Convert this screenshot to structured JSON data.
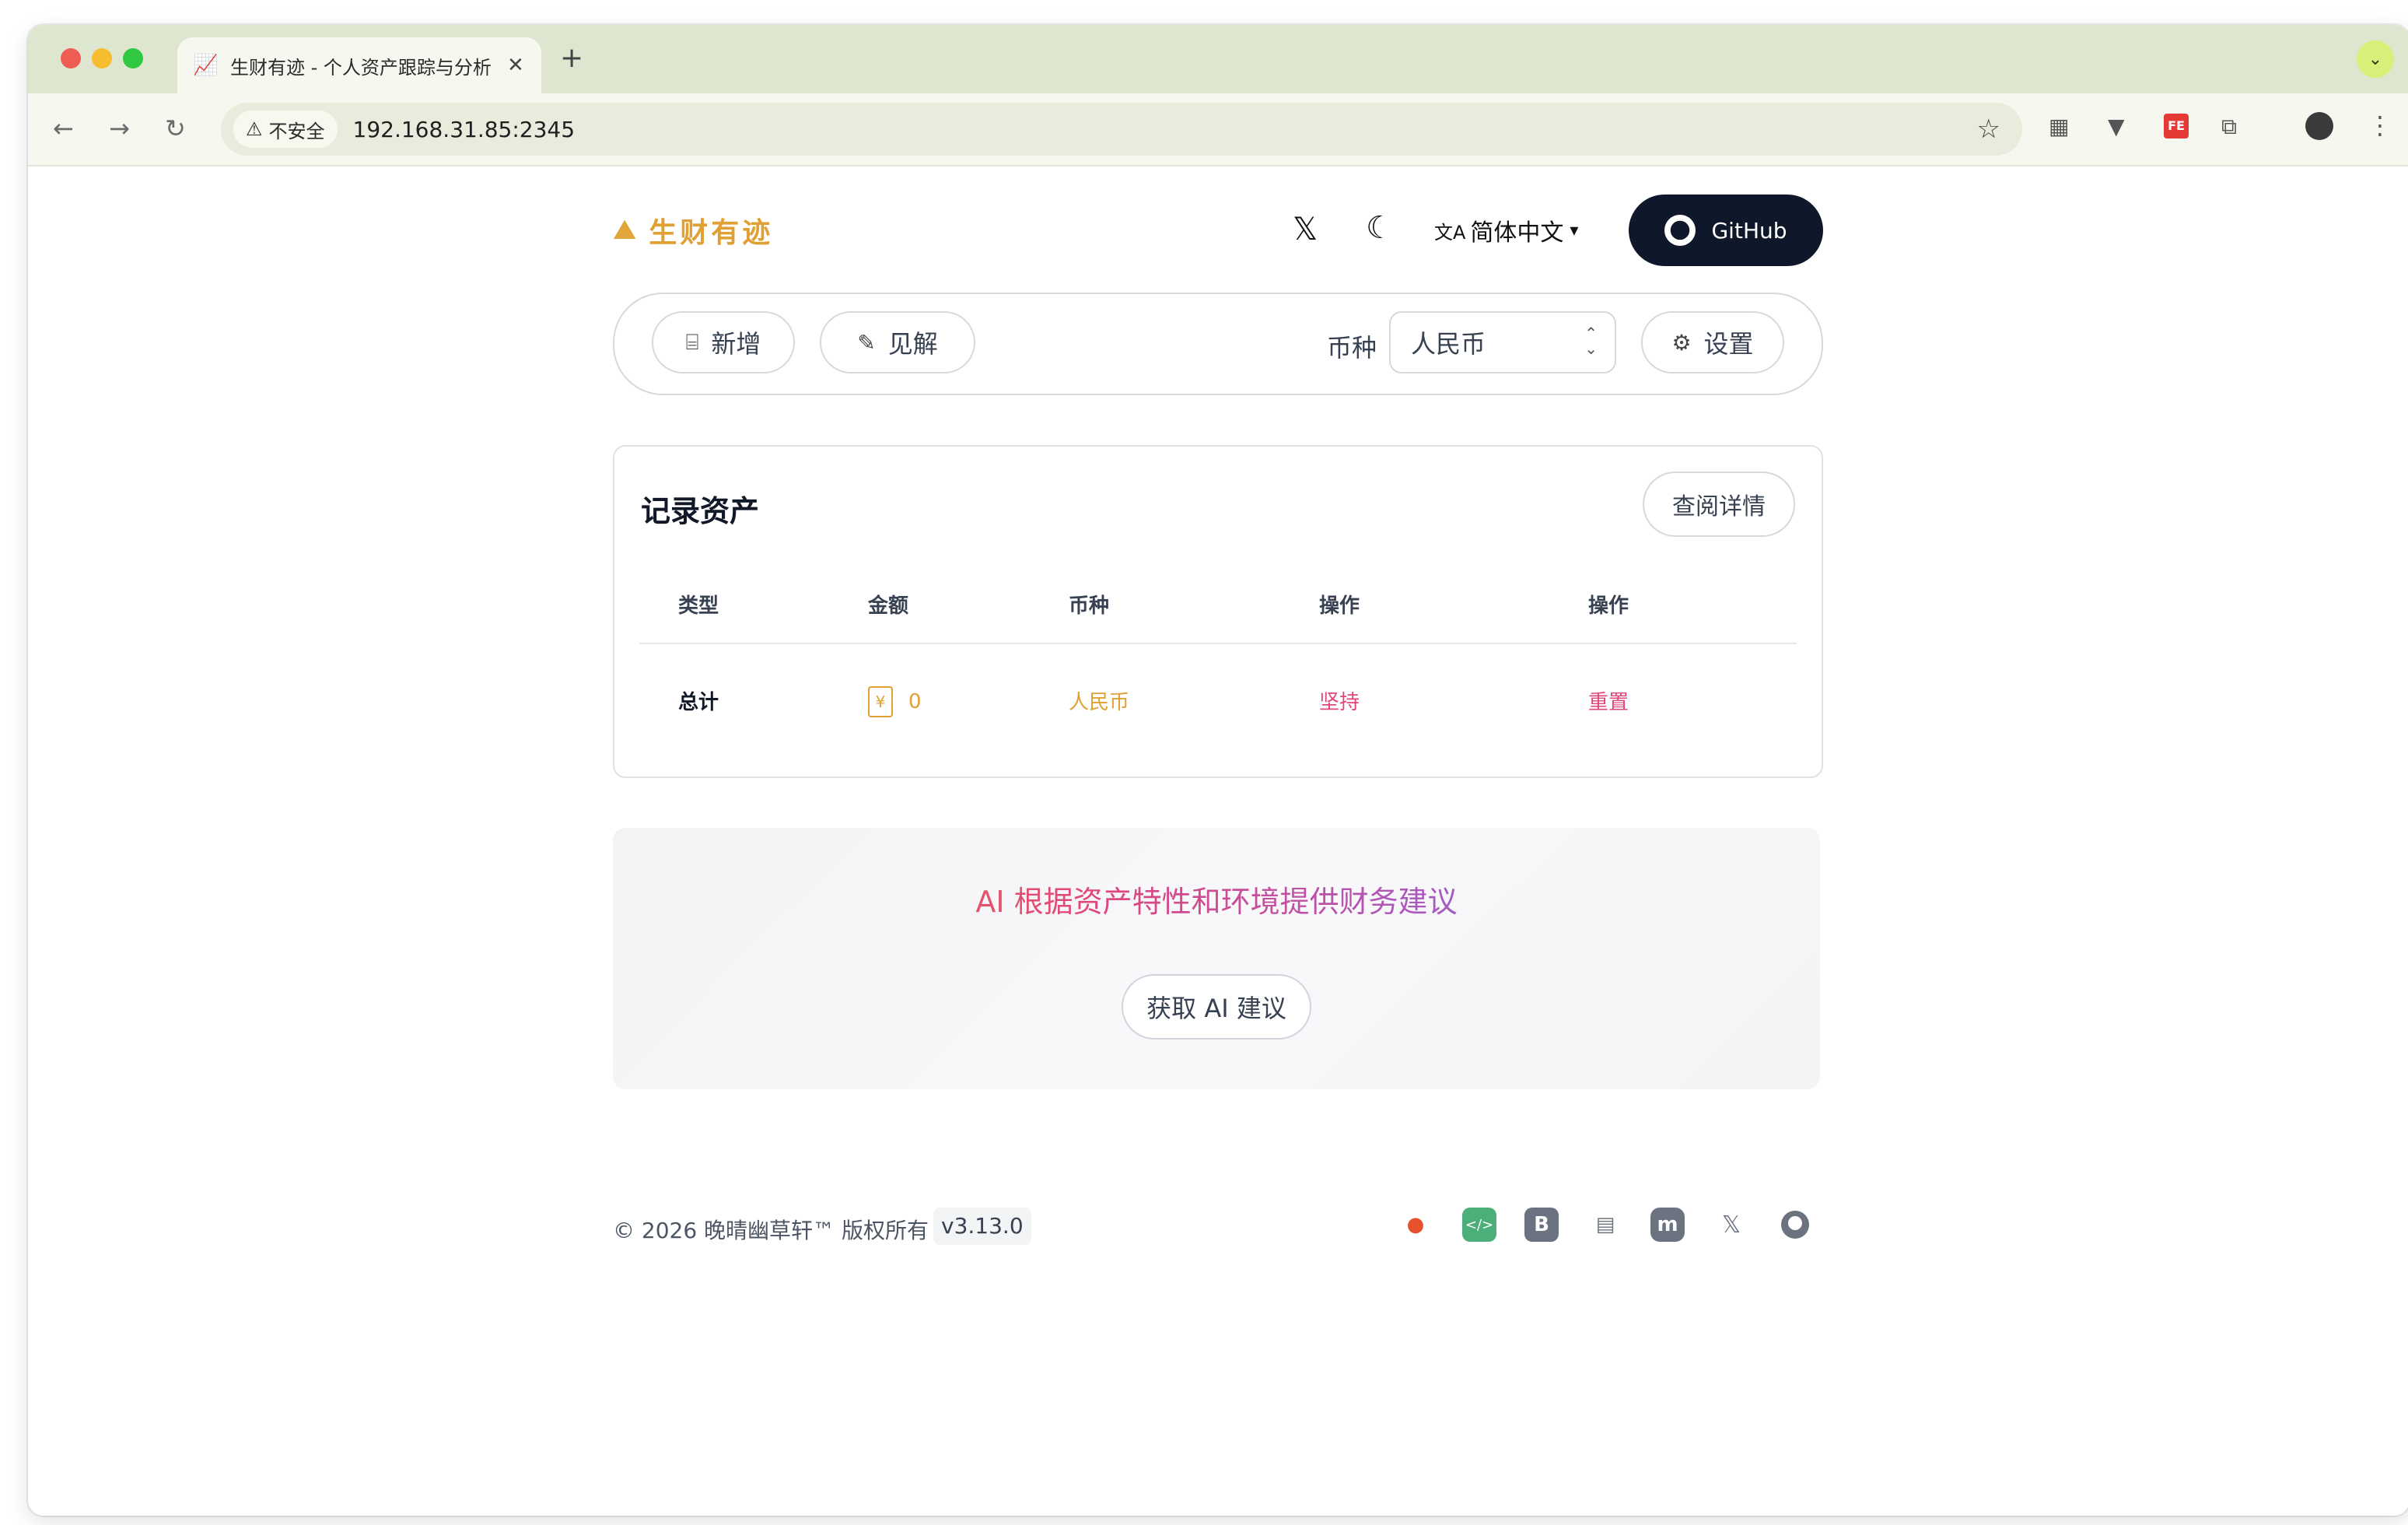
{
  "browser": {
    "tab_title": "生财有迹 - 个人资产跟踪与分析",
    "tab_favicon": "chart-favicon",
    "new_tab_symbol": "+",
    "tab_close_symbol": "✕",
    "security_label": "不安全",
    "url": "192.168.31.85:2345"
  },
  "header": {
    "logo_text": "生财有迹",
    "language": "简体中文",
    "github_label": "GitHub"
  },
  "toolbar": {
    "add_label": "新增",
    "insight_label": "见解",
    "currency_label": "币种",
    "currency_value": "人民币",
    "settings_label": "设置"
  },
  "record": {
    "title": "记录资产",
    "detail_button": "查阅详情",
    "columns": [
      "类型",
      "金额",
      "币种",
      "操作",
      "操作"
    ],
    "row": {
      "type": "总计",
      "currency_symbol": "¥",
      "amount": "0",
      "currency": "人民币",
      "action_keep": "坚持",
      "action_reset": "重置"
    }
  },
  "ai": {
    "headline": "AI 根据资产特性和环境提供财务建议",
    "button": "获取 AI 建议"
  },
  "footer": {
    "copyright": "© 2026 晚晴幽草轩™ 版权所有",
    "version": "v3.13.0",
    "icons": [
      "tomato-icon",
      "code-icon",
      "blogger-icon",
      "archive-icon",
      "mastodon-icon",
      "x-icon",
      "github-icon"
    ]
  },
  "colors": {
    "accent_gold": "#e0a033",
    "accent_pink": "#e0457b",
    "github_bg": "#0f172a"
  }
}
